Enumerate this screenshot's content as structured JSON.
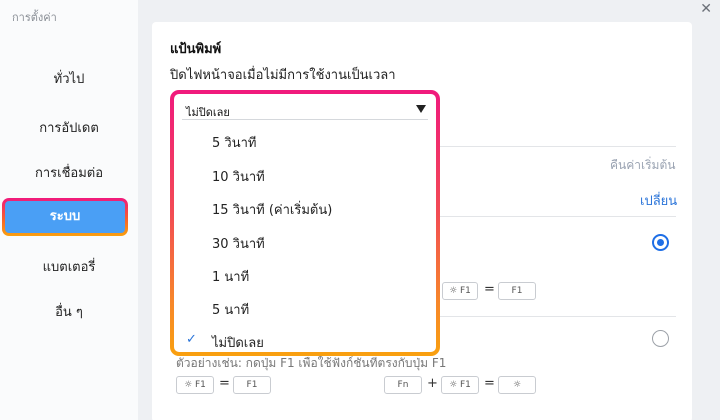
{
  "window": {
    "title": "การตั้งค่า",
    "close_icon": "close-icon"
  },
  "sidebar": {
    "items": [
      {
        "label": "ทั่วไป"
      },
      {
        "label": "การอัปเดต"
      },
      {
        "label": "การเชื่อมต่อ"
      },
      {
        "label": "ระบบ",
        "active": true
      },
      {
        "label": "แบตเตอรี่"
      },
      {
        "label": "อื่น ๆ"
      }
    ]
  },
  "content": {
    "section_title": "แป้นพิมพ์",
    "section_desc": "ปิดไฟหน้าจอเมื่อไม่มีการใช้งานเป็นเวลา",
    "reset_label": "คืนค่าเริ่มต้น",
    "change_label": "เปลี่ยน",
    "example_text": "ตัวอย่างเช่น: กดปุ่ม F1 เพื่อใช้ฟังก์ชันที่ตรงกับปุ่ม F1",
    "keys": {
      "f1_with_icon": "☼ F1",
      "f1": "F1",
      "fn": "Fn",
      "sun": "☼",
      "equals": "=",
      "plus": "+"
    },
    "radio_1_selected": true,
    "radio_2_selected": false
  },
  "dropdown": {
    "selected_value": "ไม่ปิดเลย",
    "options": [
      {
        "label": "5 วินาที",
        "checked": false
      },
      {
        "label": "10 วินาที",
        "checked": false
      },
      {
        "label": "15 วินาที (ค่าเริ่มต้น)",
        "checked": false
      },
      {
        "label": "30 วินาที",
        "checked": false
      },
      {
        "label": "1 นาที",
        "checked": false
      },
      {
        "label": "5 นาที",
        "checked": false
      },
      {
        "label": "ไม่ปิดเลย",
        "checked": true
      }
    ],
    "check_mark": "✓"
  },
  "colors": {
    "accent": "#4a9ff5",
    "link": "#2a74d9",
    "highlight_gradient_start": "#f0197d",
    "highlight_gradient_end": "#f9a00f"
  }
}
